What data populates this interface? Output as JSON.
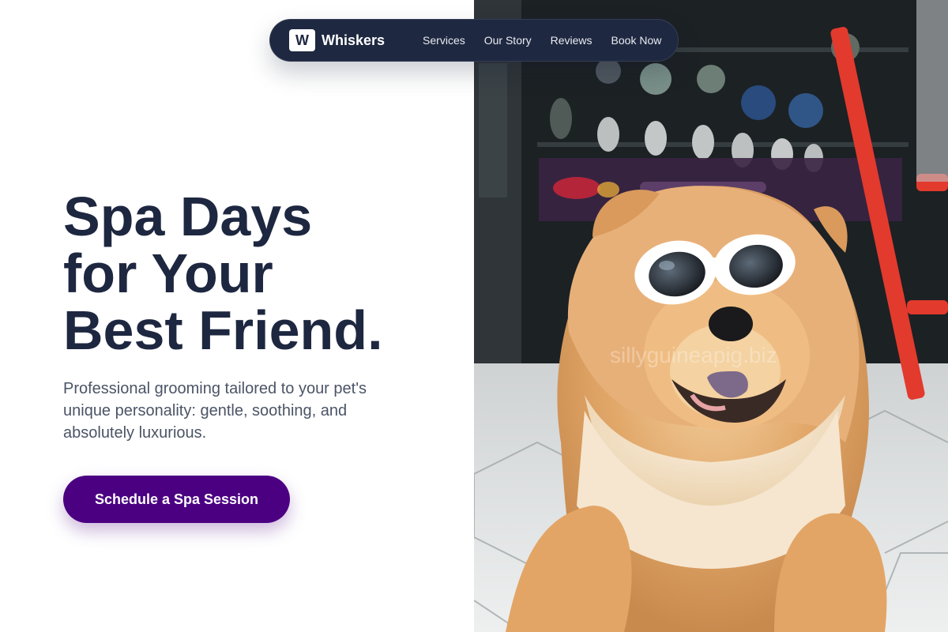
{
  "nav": {
    "logo_letter": "W",
    "brand": "Whiskers",
    "links": [
      {
        "label": "Services"
      },
      {
        "label": "Our Story"
      },
      {
        "label": "Reviews"
      },
      {
        "label": "Book Now"
      }
    ]
  },
  "hero": {
    "headline_lines": [
      "Spa Days",
      "for Your",
      "Best Friend."
    ],
    "subtext": "Professional grooming tailored to your pet's unique personality: gentle, soothing, and absolutely luxurious.",
    "cta_label": "Schedule a Spa Session"
  },
  "photo": {
    "watermark": "sillyguineapig.biz"
  },
  "colors": {
    "heading": "#1e2740",
    "nav_bg": "#1e2840",
    "cta_bg": "#4b0082",
    "body_text": "#4b5466"
  },
  "icons": [
    "logo-mark"
  ]
}
